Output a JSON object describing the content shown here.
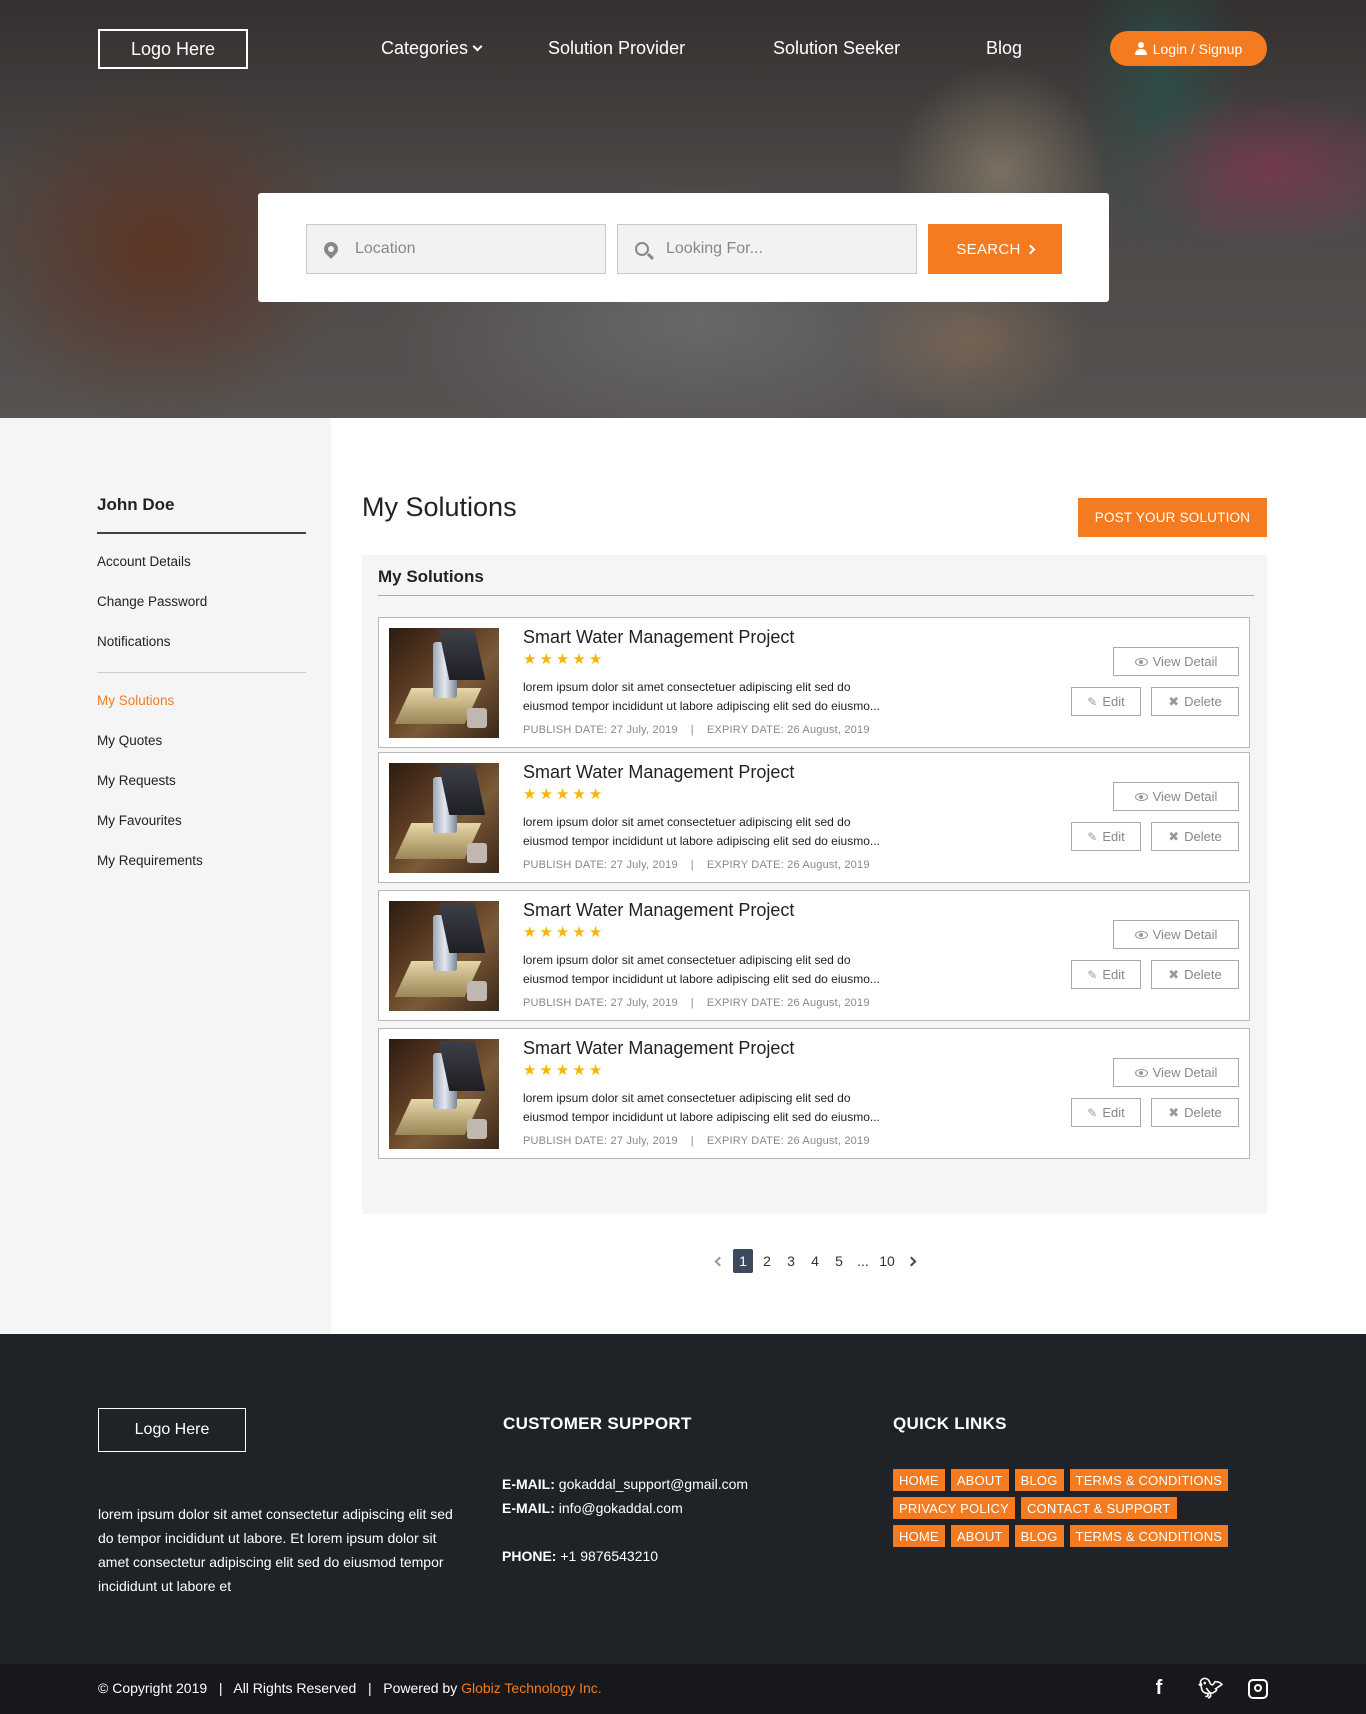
{
  "header": {
    "logo": "Logo Here",
    "nav": [
      "Categories",
      "Solution Provider",
      "Solution Seeker",
      "Blog"
    ],
    "login_label": "Login / Signup"
  },
  "search": {
    "location_placeholder": "Location",
    "looking_placeholder": "Looking For...",
    "button_label": "SEARCH"
  },
  "sidebar": {
    "user_name": "John Doe",
    "account_items": [
      "Account Details",
      "Change Password",
      "Notifications"
    ],
    "nav_items": [
      "My Solutions",
      "My Quotes",
      "My Requests",
      "My Favourites",
      "My Requirements"
    ],
    "active_item": "My Solutions"
  },
  "main": {
    "title": "My Solutions",
    "post_button": "POST YOUR SOLUTION",
    "panel_title": "My Solutions",
    "cards": [
      {
        "title": "Smart Water Management Project",
        "rating": 5,
        "desc_line1": "lorem ipsum dolor sit amet consectetuer adipiscing elit sed do",
        "desc_line2": "eiusmod tempor incididunt ut labore adipiscing elit sed do eiusmo...",
        "meta": "PUBLISH DATE: 27 July, 2019    |    EXPIRY DATE: 26 August, 2019",
        "view_label": "View Detail",
        "edit_label": "Edit",
        "delete_label": "Delete"
      },
      {
        "title": "Smart Water Management Project",
        "rating": 5,
        "desc_line1": "lorem ipsum dolor sit amet consectetuer adipiscing elit sed do",
        "desc_line2": "eiusmod tempor incididunt ut labore adipiscing elit sed do eiusmo...",
        "meta": "PUBLISH DATE: 27 July, 2019    |    EXPIRY DATE: 26 August, 2019",
        "view_label": "View Detail",
        "edit_label": "Edit",
        "delete_label": "Delete"
      },
      {
        "title": "Smart Water Management Project",
        "rating": 5,
        "desc_line1": "lorem ipsum dolor sit amet consectetuer adipiscing elit sed do",
        "desc_line2": "eiusmod tempor incididunt ut labore adipiscing elit sed do eiusmo...",
        "meta": "PUBLISH DATE: 27 July, 2019    |    EXPIRY DATE: 26 August, 2019",
        "view_label": "View Detail",
        "edit_label": "Edit",
        "delete_label": "Delete"
      },
      {
        "title": "Smart Water Management Project",
        "rating": 5,
        "desc_line1": "lorem ipsum dolor sit amet consectetuer adipiscing elit sed do",
        "desc_line2": "eiusmod tempor incididunt ut labore adipiscing elit sed do eiusmo...",
        "meta": "PUBLISH DATE: 27 July, 2019    |    EXPIRY DATE: 26 August, 2019",
        "view_label": "View Detail",
        "edit_label": "Edit",
        "delete_label": "Delete"
      }
    ]
  },
  "pagination": {
    "pages": [
      "1",
      "2",
      "3",
      "4",
      "5",
      "...",
      "10"
    ],
    "current": "1"
  },
  "footer": {
    "logo": "Logo Here",
    "about": "lorem ipsum dolor sit amet consectetur adipiscing elit sed do tempor incididunt ut labore.  Et lorem ipsum dolor sit amet consectetur adipiscing elit sed do eiusmod tempor incididunt ut labore et",
    "support_heading": "CUSTOMER SUPPORT",
    "email1_label": "E-MAIL:",
    "email1": "gokaddal_support@gmail.com",
    "email2_label": "E-MAIL:",
    "email2": "info@gokaddal.com",
    "phone_label": "PHONE:",
    "phone": "+1 9876543210",
    "links_heading": "QUICK LINKS",
    "quick_links_rows": [
      [
        "HOME",
        "ABOUT",
        "BLOG",
        "TERMS & CONDITIONS"
      ],
      [
        "PRIVACY POLICY",
        "CONTACT & SUPPORT"
      ],
      [
        "HOME",
        "ABOUT",
        "BLOG",
        "TERMS & CONDITIONS"
      ]
    ]
  },
  "bottom": {
    "copyright": "© Copyright 2019   |   All Rights Reserved   |   Powered by ",
    "brand": "Globiz Technology Inc."
  },
  "colors": {
    "accent": "#f47b20",
    "star": "#f7b500",
    "footer_bg": "#1f2226",
    "pager_active": "#3b4a5e"
  },
  "icons": [
    "chevron-down-icon",
    "user-icon",
    "location-pin-icon",
    "search-icon",
    "chevron-right-icon",
    "star-icon",
    "eye-icon",
    "pencil-icon",
    "close-icon",
    "facebook-icon",
    "twitter-icon",
    "instagram-icon"
  ]
}
